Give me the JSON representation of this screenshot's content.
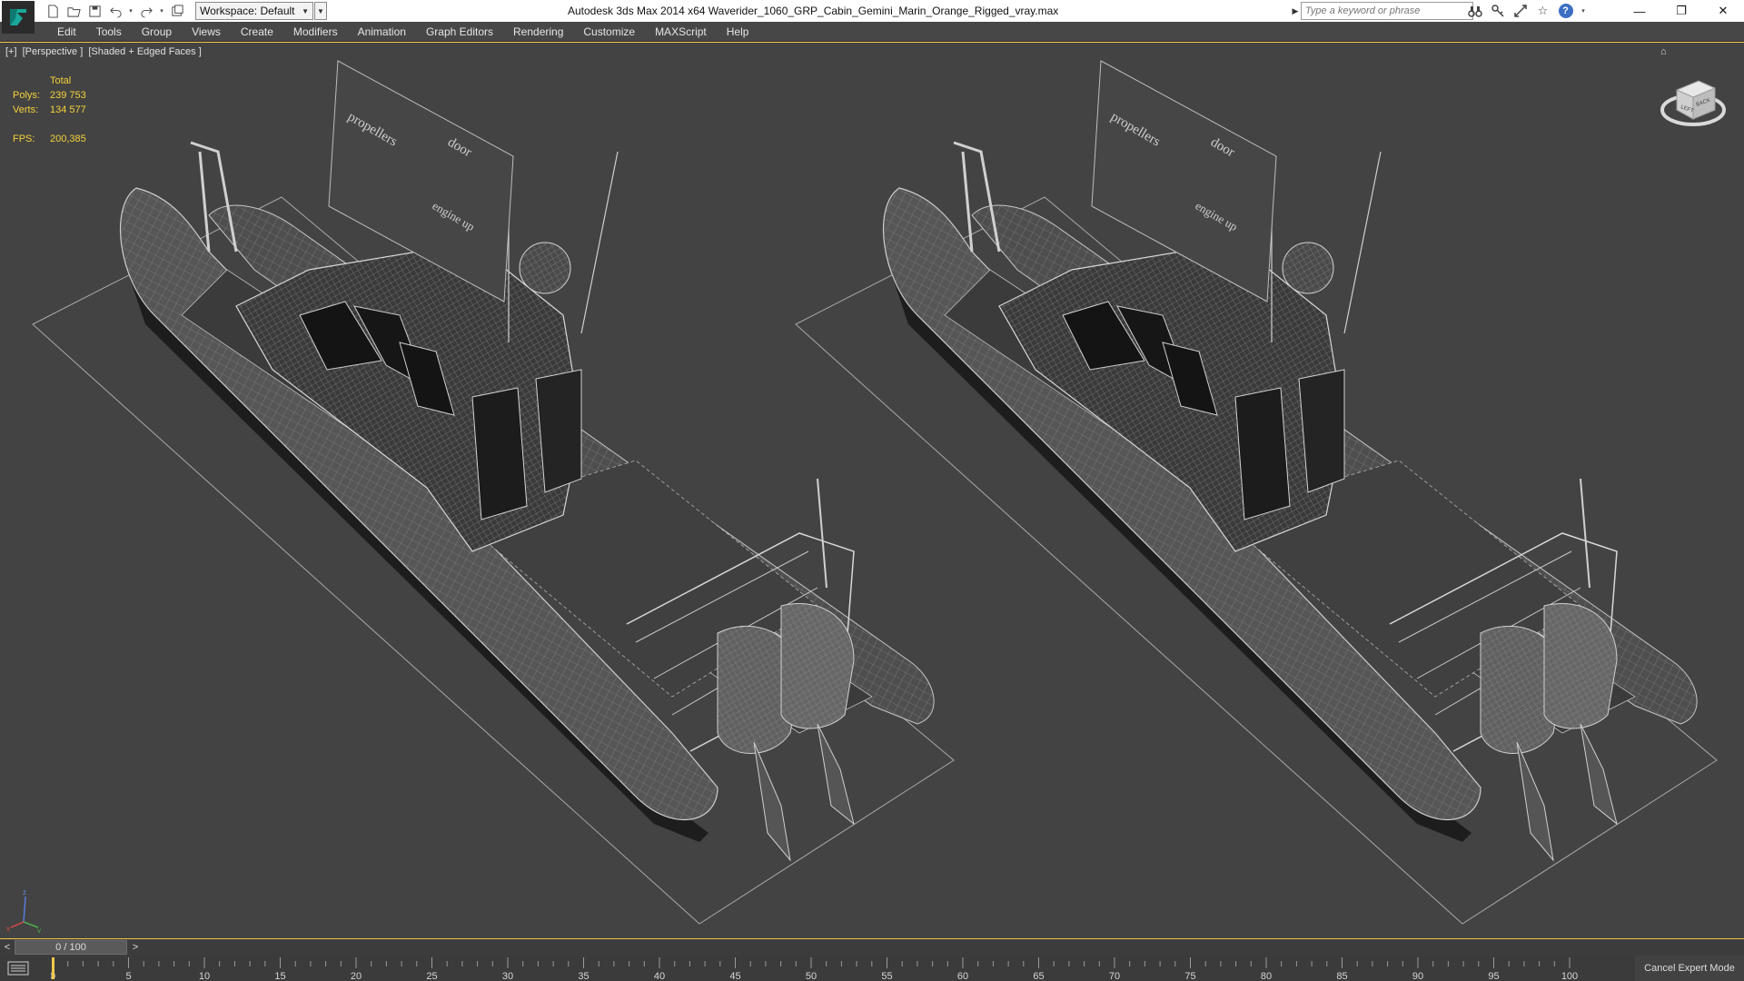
{
  "app": {
    "title": "Autodesk 3ds Max  2014 x64     Waverider_1060_GRP_Cabin_Gemini_Marin_Orange_Rigged_vray.max",
    "workspace_label": "Workspace: Default",
    "search_placeholder": "Type a keyword or phrase"
  },
  "menu": [
    "Edit",
    "Tools",
    "Group",
    "Views",
    "Create",
    "Modifiers",
    "Animation",
    "Graph Editors",
    "Rendering",
    "Customize",
    "MAXScript",
    "Help"
  ],
  "viewport": {
    "label_parts": [
      "[+]",
      "[Perspective ]",
      "[Shaded + Edged Faces ]"
    ],
    "stats": {
      "header": "Total",
      "polys_label": "Polys:",
      "polys_value": "239 753",
      "verts_label": "Verts:",
      "verts_value": "134 577",
      "fps_label": "FPS:",
      "fps_value": "200,385"
    },
    "panel_texts": [
      "propellers",
      "door",
      "engine up"
    ],
    "viewcube_labels": [
      "LEFT",
      "BACK"
    ]
  },
  "timeline": {
    "slider_text": "0 / 100",
    "prev_label": "<",
    "next_label": ">",
    "ticks": [
      0,
      5,
      10,
      15,
      20,
      25,
      30,
      35,
      40,
      45,
      50,
      55,
      60,
      65,
      70,
      75,
      80,
      85,
      90,
      95,
      100
    ],
    "current_frame": 0,
    "total_frames": 100
  },
  "status": {
    "expert_mode_label": "Cancel Expert Mode"
  },
  "colors": {
    "viewport_bg": "#434343",
    "highlight": "#f2c94c",
    "stats_text": "#f5d23a",
    "wire": "#c9c9c9"
  }
}
